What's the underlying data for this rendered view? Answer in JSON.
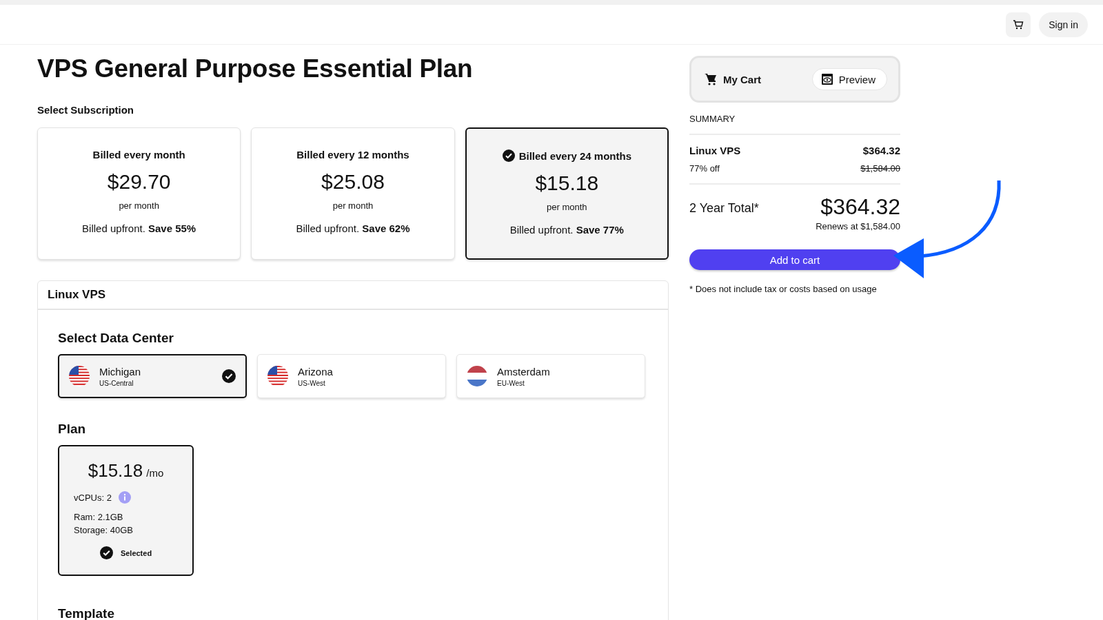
{
  "header": {
    "sign_in": "Sign in"
  },
  "title": "VPS General Purpose Essential Plan",
  "subscription": {
    "heading": "Select Subscription",
    "options": [
      {
        "label": "Billed every month",
        "price": "$29.70",
        "period": "per month",
        "note": "Billed upfront. **Save 55%**",
        "selected": false
      },
      {
        "label": "Billed every 12 months",
        "price": "$25.08",
        "period": "per month",
        "note": "Billed upfront. **Save 62%**",
        "selected": false
      },
      {
        "label": "Billed every 24 months",
        "price": "$15.18",
        "period": "per month",
        "note": "Billed upfront. **Save 77%**",
        "selected": true
      }
    ]
  },
  "product": {
    "title": "Linux VPS",
    "data_center": {
      "heading": "Select Data Center",
      "options": [
        {
          "name": "Michigan",
          "region": "US-Central",
          "kind": "us",
          "selected": true
        },
        {
          "name": "Arizona",
          "region": "US-West",
          "kind": "us",
          "selected": false
        },
        {
          "name": "Amsterdam",
          "region": "EU-West",
          "kind": "nl",
          "selected": false
        }
      ]
    },
    "plan": {
      "heading": "Plan",
      "price": "$15.18",
      "unit": "/mo",
      "vcpus": "vCPUs: 2",
      "ram": "Ram: 2.1GB",
      "storage": "Storage: 40GB",
      "status": "Selected",
      "selected": true
    },
    "template_heading": "Template"
  },
  "cart": {
    "title": "My Cart",
    "preview": "Preview",
    "summary": "SUMMARY",
    "item": "Linux VPS",
    "item_price": "$364.32",
    "discount": "77% off",
    "old_price": "$1,584.00",
    "total_label": "2 Year Total*",
    "total": "$364.32",
    "renews": "Renews at $1,584.00",
    "add_button": "Add to cart",
    "footnote": "* Does not include tax or costs based on usage"
  }
}
